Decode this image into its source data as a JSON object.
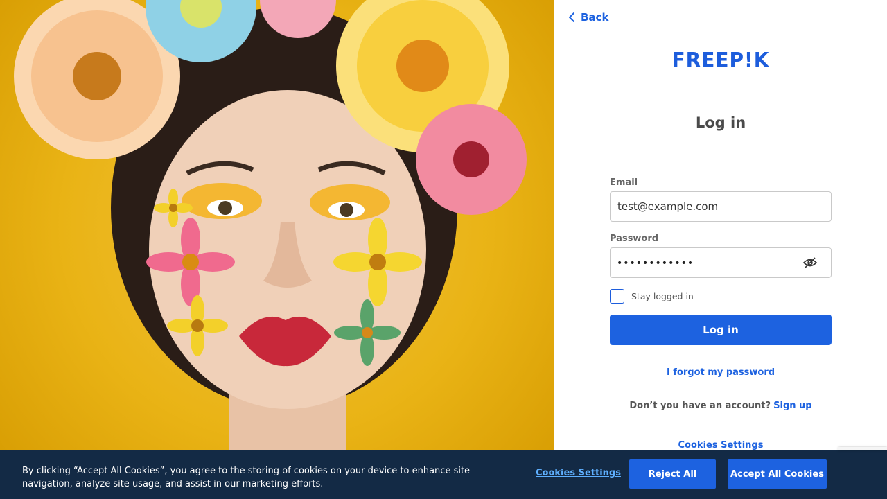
{
  "hero": {
    "image_alt": "Woman with flowers on her face and in her hair"
  },
  "nav": {
    "back_label": "Back"
  },
  "brand": {
    "logo_text": "FREEP!K"
  },
  "form": {
    "title": "Log in",
    "email_label": "Email",
    "email_value": "test@example.com",
    "password_label": "Password",
    "password_masked": "••••••••••••",
    "stay_logged_in_label": "Stay logged in",
    "stay_logged_in_checked": false,
    "login_button": "Log in",
    "forgot_password": "I forgot my password",
    "no_account_text": "Don’t you have an account?",
    "signup_link": "Sign up",
    "cookies_settings_link": "Cookies Settings"
  },
  "cookie_banner": {
    "text": "By clicking “Accept All Cookies”, you agree to the storing of cookies on your device to enhance site navigation, analyze site usage, and assist in our marketing efforts.",
    "settings_label": "Cookies Settings",
    "reject_label": "Reject All",
    "accept_label": "Accept All Cookies"
  },
  "colors": {
    "accent": "#1d62e0",
    "banner_bg": "#132a45",
    "hero_bg": "#e9b315"
  }
}
